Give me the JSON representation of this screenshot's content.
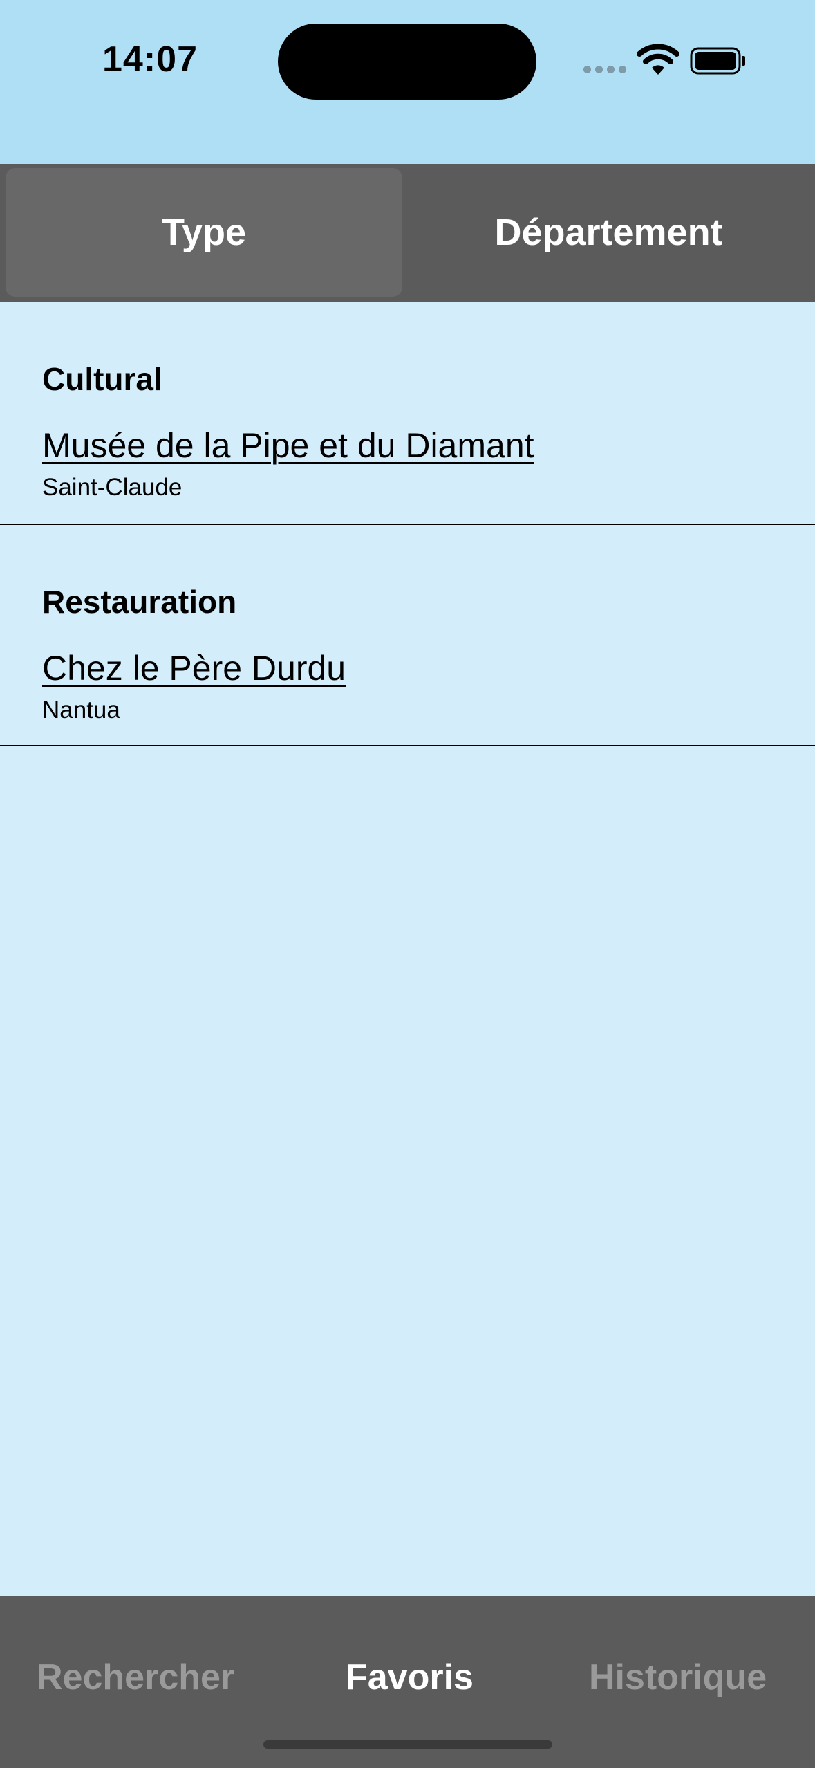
{
  "status_bar": {
    "time": "14:07",
    "icons": [
      "cellular-signal-icon",
      "wifi-icon",
      "battery-icon"
    ]
  },
  "segmented_control": {
    "segments": [
      "Type",
      "Département"
    ],
    "selected": "Type"
  },
  "sections": [
    {
      "title": "Cultural",
      "items": [
        {
          "name": "Musée de la Pipe et du Diamant",
          "city": "Saint-Claude"
        }
      ]
    },
    {
      "title": "Restauration",
      "items": [
        {
          "name": "Chez le Père Durdu",
          "city": "Nantua"
        }
      ]
    }
  ],
  "tab_bar": {
    "tabs": [
      "Rechercher",
      "Favoris",
      "Historique"
    ],
    "selected": "Favoris"
  },
  "colors": {
    "status_bar_bg": "#afdff5",
    "content_bg": "#d3edfa",
    "bar_bg": "#5b5b5b",
    "selected_segment_bg": "#686868",
    "active_tab": "#ffffff",
    "inactive_tab": "#9a9a9a"
  }
}
